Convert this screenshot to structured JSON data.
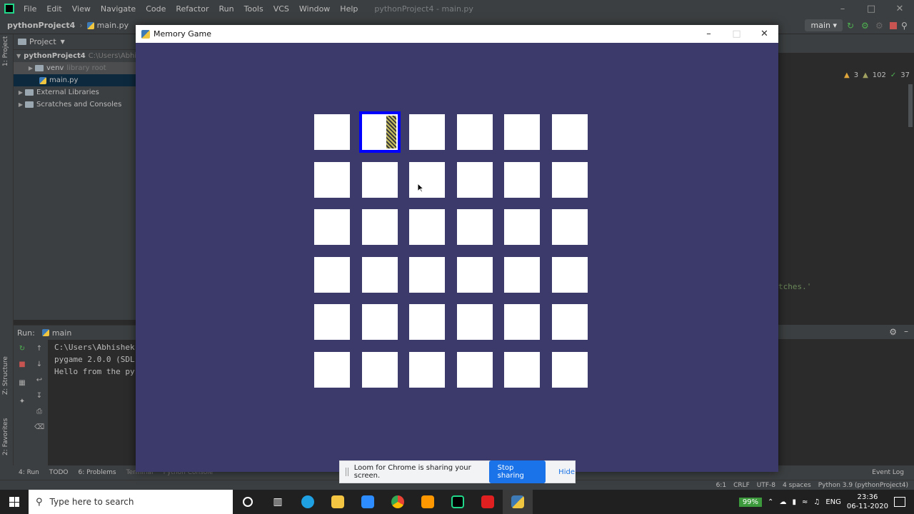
{
  "ide": {
    "menu": [
      "File",
      "Edit",
      "View",
      "Navigate",
      "Code",
      "Refactor",
      "Run",
      "Tools",
      "VCS",
      "Window",
      "Help"
    ],
    "window_title": "pythonProject4 - main.py",
    "breadcrumb": {
      "project": "pythonProject4",
      "file": "main.py"
    },
    "branch": "main",
    "project_panel": {
      "title": "Project",
      "root": "pythonProject4",
      "root_path": "C:\\Users\\Abhi",
      "venv": "venv",
      "venv_note": "library root",
      "main_file": "main.py",
      "external": "External Libraries",
      "scratches": "Scratches and Consoles"
    },
    "stripe": {
      "project": "1: Project",
      "structure": "Z: Structure",
      "favorites": "2: Favorites"
    },
    "run_panel": {
      "label": "Run:",
      "config": "main",
      "console": [
        "C:\\Users\\Abhishek",
        "pygame 2.0.0 (SDL",
        "Hello from the py"
      ]
    },
    "inspections": {
      "warnings": "3",
      "weak_warnings": "102",
      "ok": "37"
    },
    "code_snippet": "tches.'",
    "bottom_tools": [
      "4: Run",
      "TODO",
      "6: Problems",
      "Terminal",
      "Python Console"
    ],
    "event_log": "Event Log",
    "status": {
      "position": "6:1",
      "line_sep": "CRLF",
      "encoding": "UTF-8",
      "indent": "4 spaces",
      "interpreter": "Python 3.9 (pythonProject4)"
    }
  },
  "game": {
    "title": "Memory Game",
    "rows": 6,
    "cols": 6,
    "selected_tile": {
      "row": 0,
      "col": 1
    },
    "colors": {
      "board": "#3c3a6a",
      "tile": "#ffffff",
      "highlight": "#0000ff"
    }
  },
  "loom": {
    "message": "Loom for Chrome is sharing your screen.",
    "stop": "Stop sharing",
    "hide": "Hide"
  },
  "taskbar": {
    "search_placeholder": "Type here to search",
    "battery": "99%",
    "language": "ENG",
    "time": "23:36",
    "date": "06-11-2020"
  }
}
